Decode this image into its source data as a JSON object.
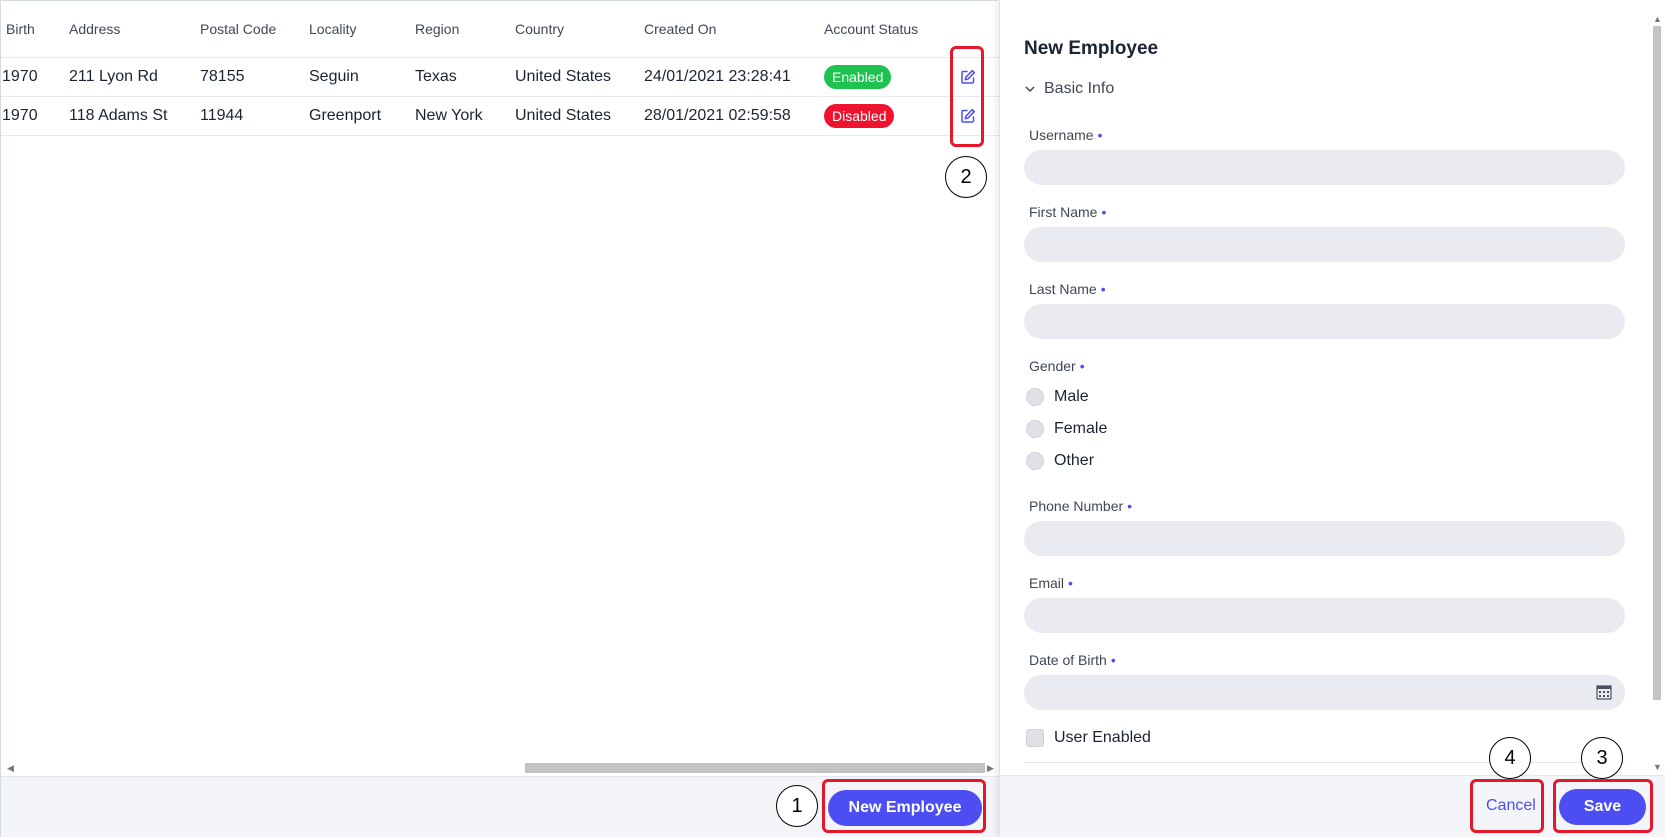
{
  "grid": {
    "columns": {
      "birth": "Birth",
      "address": "Address",
      "postal_code": "Postal Code",
      "locality": "Locality",
      "region": "Region",
      "country": "Country",
      "created_on": "Created On",
      "account_status": "Account Status"
    },
    "rows": [
      {
        "birth": "1970",
        "address": "211 Lyon Rd",
        "postal_code": "78155",
        "locality": "Seguin",
        "region": "Texas",
        "country": "United States",
        "created_on": "24/01/2021 23:28:41",
        "status": "Enabled"
      },
      {
        "birth": "1970",
        "address": "118 Adams St",
        "postal_code": "11944",
        "locality": "Greenport",
        "region": "New York",
        "country": "United States",
        "created_on": "28/01/2021 02:59:58",
        "status": "Disabled"
      }
    ],
    "footer": {
      "new_employee_label": "New Employee"
    }
  },
  "panel": {
    "title": "New Employee",
    "section_label": "Basic Info",
    "fields": {
      "username": "Username",
      "first_name": "First Name",
      "last_name": "Last Name",
      "gender": "Gender",
      "phone": "Phone Number",
      "email": "Email",
      "dob": "Date of Birth",
      "required_marker": "•"
    },
    "gender_options": [
      "Male",
      "Female",
      "Other"
    ],
    "user_enabled_label": "User Enabled",
    "cancel_label": "Cancel",
    "save_label": "Save"
  },
  "annotations": {
    "n1": "1",
    "n2": "2",
    "n3": "3",
    "n4": "4"
  },
  "colors": {
    "accent": "#4c4ef2",
    "enabled": "#1ec24f",
    "disabled": "#ee1430",
    "highlight": "#e5172a"
  },
  "icons": {
    "edit": "edit-icon",
    "chevron": "chevron-down-icon",
    "calendar": "calendar-icon"
  }
}
